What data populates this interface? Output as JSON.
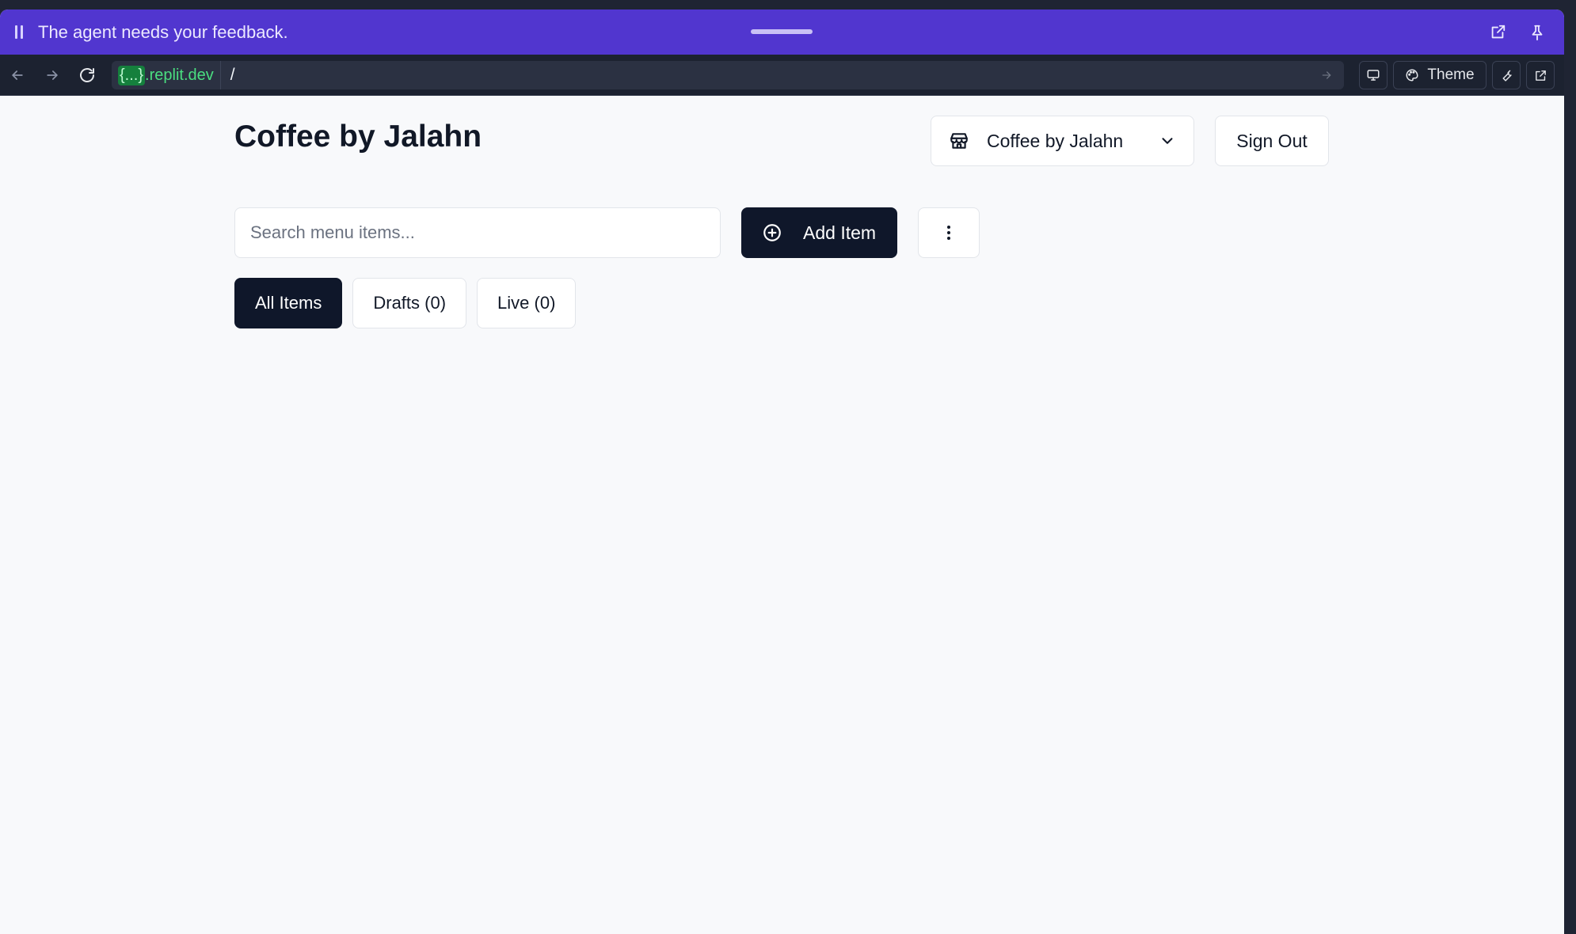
{
  "banner": {
    "message": "The agent needs your feedback.",
    "icons": [
      "pause-icon",
      "drag-handle",
      "expand-icon",
      "pin-icon"
    ]
  },
  "browser": {
    "domain_mask": "{...}",
    "domain_suffix": ".replit.dev",
    "path": "/",
    "theme_label": "Theme",
    "icons": [
      "back-icon",
      "forward-icon",
      "reload-icon",
      "go-arrow-icon",
      "monitor-icon",
      "palette-icon",
      "wrench-icon",
      "external-link-icon"
    ]
  },
  "header": {
    "title": "Coffee by Jalahn",
    "store_select": {
      "selected": "Coffee by Jalahn",
      "icon": "store-icon"
    },
    "sign_out_label": "Sign Out"
  },
  "toolbar": {
    "search_placeholder": "Search menu items...",
    "add_item_label": "Add Item"
  },
  "tabs": [
    {
      "label": "All Items",
      "active": true
    },
    {
      "label": "Drafts (0)",
      "active": false
    },
    {
      "label": "Live (0)",
      "active": false
    }
  ],
  "colors": {
    "banner": "#5136cf",
    "browser_bar": "#1c2230",
    "primary": "#0f172a",
    "domain_green": "#4ade80"
  }
}
